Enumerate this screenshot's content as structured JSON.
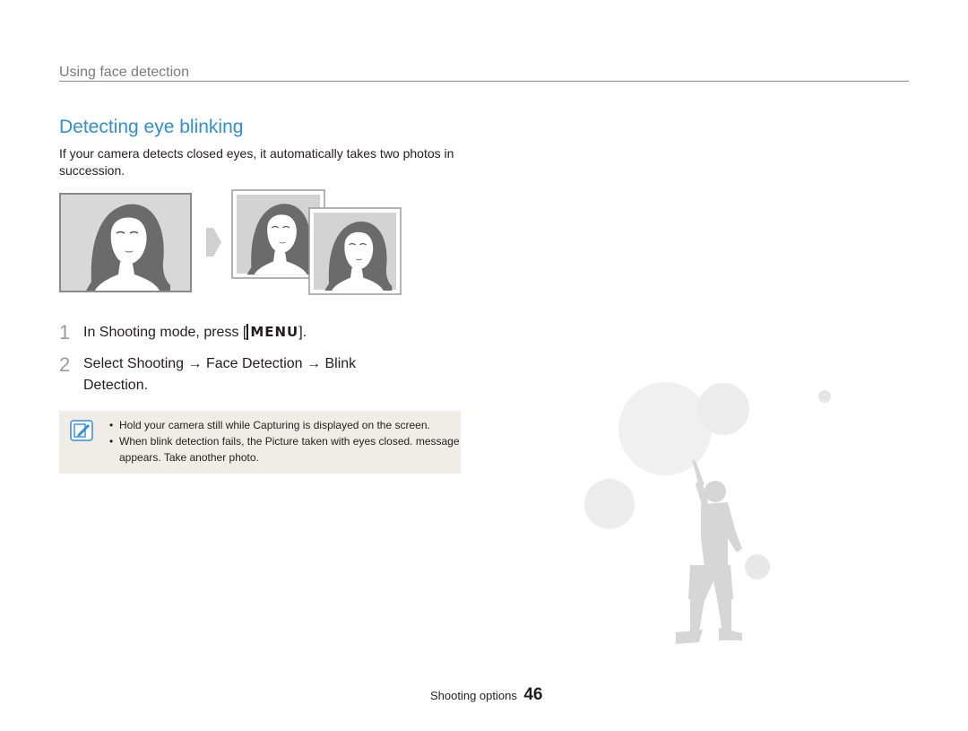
{
  "header": {
    "section": "Using face detection"
  },
  "page_title": "Detecting eye blinking",
  "intro": "If your camera detects closed eyes, it automatically takes two photos in succession.",
  "illustration": {
    "icon": "face-closed-eyes-photo-to-two-photos-icon",
    "arrow_icon": "arrow-right-icon"
  },
  "steps": [
    {
      "number": "1",
      "text_before": "In Shooting mode, press [",
      "key": "MENU",
      "text_after": "]."
    },
    {
      "number": "2",
      "text": "Select Shooting → Face Detection → Blink Detection."
    }
  ],
  "note": {
    "icon": "note-pencil-icon",
    "items": [
      "Hold your camera still while  Capturing  is displayed on the screen.",
      "When blink detection fails, the  Picture taken with eyes closed.  message appears. Take another photo."
    ]
  },
  "footer": {
    "label": "Shooting options",
    "page": "46"
  },
  "colors": {
    "title": "#2e8fd8",
    "note_bg": "#efede6",
    "step_number": "#9a9a9a"
  }
}
